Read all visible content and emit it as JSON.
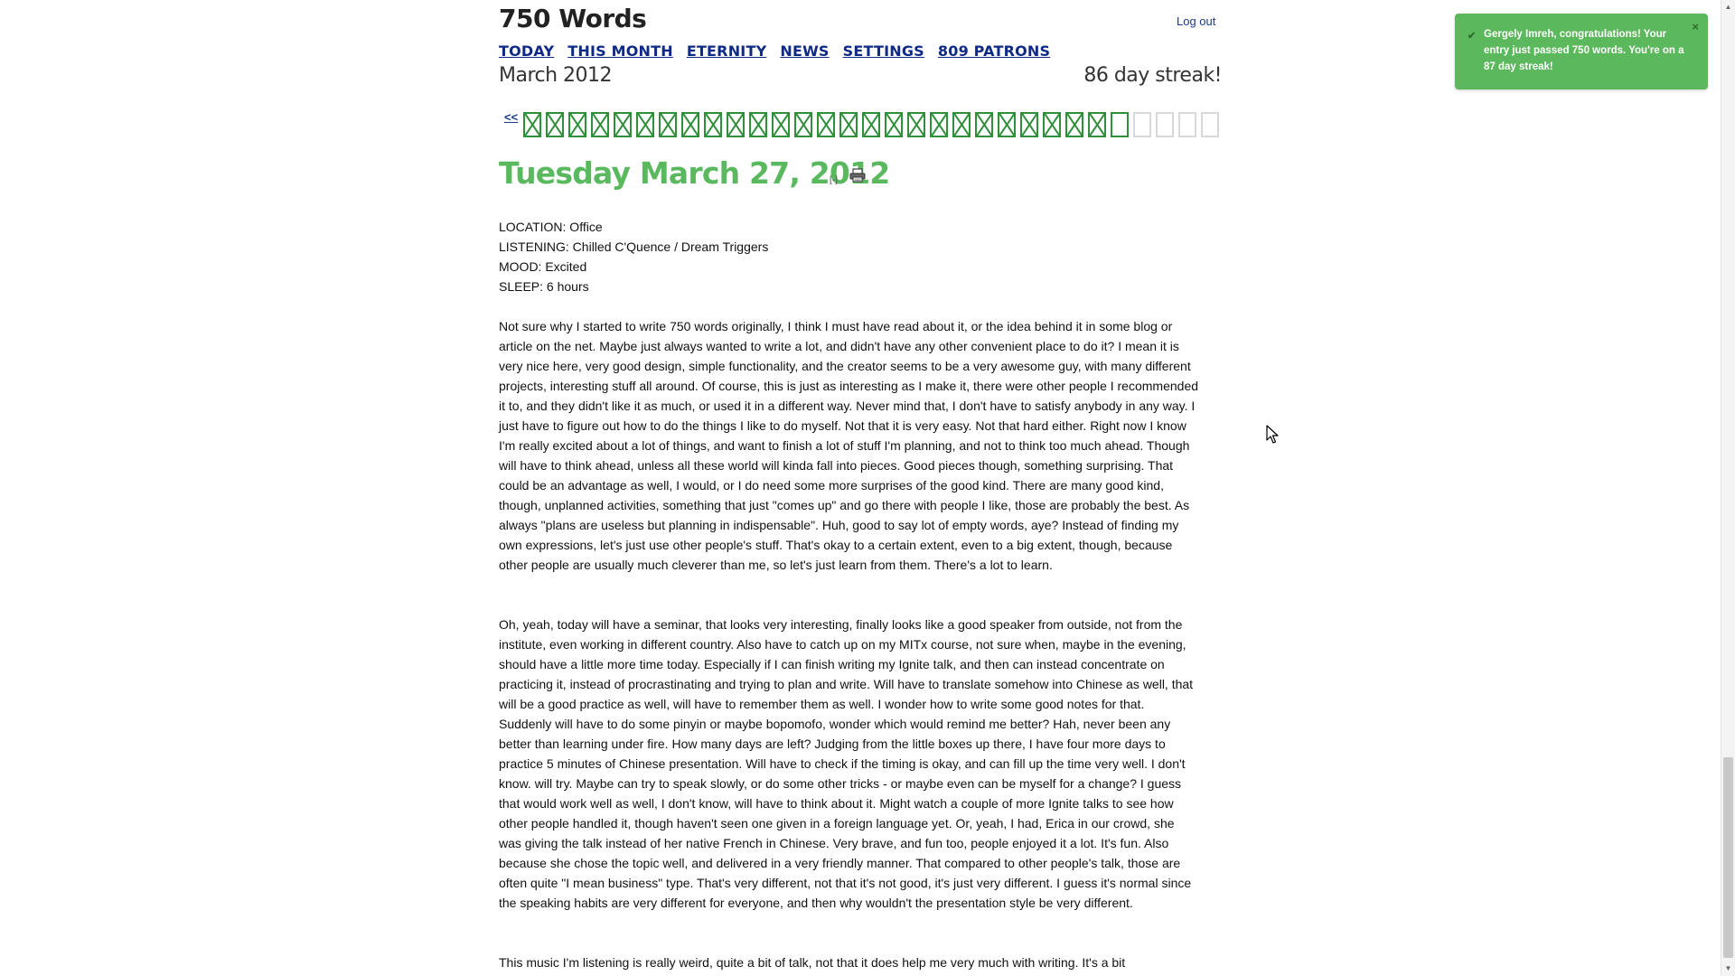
{
  "site": {
    "title": "750 Words",
    "logout_label": "Log out"
  },
  "nav": {
    "items": [
      "TODAY",
      "THIS MONTH",
      "ETERNITY",
      "NEWS",
      "SETTINGS",
      "809 PATRONS"
    ]
  },
  "month": {
    "title": "March 2012",
    "streak": "86 day streak!",
    "prev_label": "<<"
  },
  "calendar": {
    "filled_days": 26,
    "today_day": 27,
    "total_days": 31
  },
  "entry": {
    "date": "Tuesday March 27, 2012",
    "collapse_label": "[-]",
    "meta": [
      "LOCATION: Office",
      "LISTENING: Chilled C'Quence / Dream Triggers",
      "MOOD: Excited",
      "SLEEP: 6 hours"
    ],
    "paragraphs": [
      "Not sure why I started to write 750 words originally, I think I must have read about it, or the idea behind it in some blog or article on the net. Maybe just always wanted to write a lot, and didn't have any other convenient place to do it? I mean it is very nice here, very good design, simple functionality, and the creator seems to be a very awesome guy, with many different projects, interesting stuff all around. Of course, this is just as interesting as I make it, there were other people I recommended it to, and they didn't like it as much, or used it in a different way. Never mind that, I don't have to satisfy anybody in any way. I just have to figure out how to do the things I like to do myself. Not that it is very easy. Not that hard either. Right now I know I'm really excited about a lot of things, and want to finish a lot of stuff I'm planning, and not to think too much ahead. Though will have to think ahead, unless all these world will kinda fall into pieces. Good pieces though, something surprising. That could be an advantage as well, I would, or I do need some more surprises of the good kind. There are many good kind, though, unplanned activities, something that just \"comes up\" and go there with people I like, those are probably the best. As always \"plans are useless but planning in indispensable\". Huh, good to say lot of empty words, aye? Instead of finding my own expressions, let's just use other people's stuff. That's okay to a certain extent, even to a big extent, though, because other people are usually much cleverer than me, so let's just learn from them. There's a lot to learn.",
      "Oh, yeah, today will have a seminar, that looks very interesting, finally looks like a good speaker from outside, not from the institute, even working in different country. Also have to catch up on my MITx course, not sure when, maybe in the evening, should have a little more time today. Especially if I can finish writing my Ignite talk, and then can instead concentrate on practicing it, instead of procrastinating and trying to plan and write. Will have to translate somehow into Chinese as well, that will be a good practice as well, will have to remember them as well. I wonder how to write some good notes for that. Suddenly will have to do some pinyin or maybe bopomofo, wonder which would remind me better? Hah, never been any better than learning under fire. How many days are left? Judging from the little boxes up there, I have four more days to practice 5 minutes of Chinese presentation. Will have to check if the timing is okay, and can fill up the time very well. I don't know. will try. Maybe can try to speak slowly, or do some other tricks - or maybe even can be myself for a change? I guess that would work well as well, I don't know, will have to think about it. Might watch a couple of more Ignite talks to see how other people handled it, though haven't seen one given in a foreign language yet. Or, yeah, I had, Erica in our crowd, she was giving the talk instead of her native French in Chinese. Very brave, and fun too, people enjoyed it a lot. It's fun. Also because she chose the topic well, and delivered in a very friendly manner. That compared to other people's talk, those are often quite \"I mean business\" type. That's very different, not that it's not good, it's just very different. I guess it's normal since the speaking habits are very different for everyone, and then why wouldn't the presentation style be very different.",
      "This music I'm listening is really weird, quite a bit of talk, not that it does help me very much with writing. It's a bit"
    ]
  },
  "toast": {
    "message": "Gergely Imreh, congratulations! Your entry just passed 750 words. You're on a 87 day streak!",
    "close_label": "×",
    "color": "#5cb85c"
  },
  "colors": {
    "accent_green": "#5ab95f",
    "box_green": "#2f8f3a",
    "link_blue": "#0e2a86"
  }
}
